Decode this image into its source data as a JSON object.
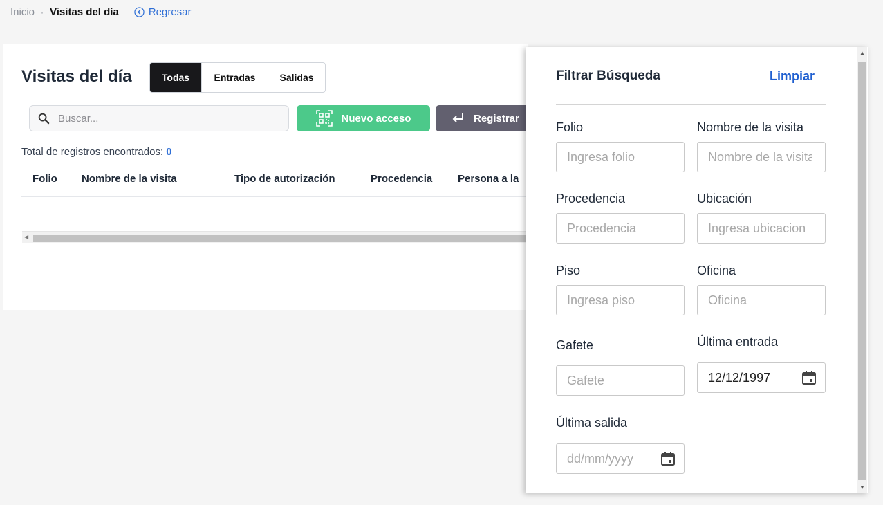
{
  "breadcrumb": {
    "home": "Inicio",
    "separator": "·",
    "current": "Visitas del día",
    "back": "Regresar"
  },
  "page": {
    "title": "Visitas del día"
  },
  "tabs": [
    {
      "label": "Todas",
      "active": true
    },
    {
      "label": "Entradas",
      "active": false
    },
    {
      "label": "Salidas",
      "active": false
    }
  ],
  "search": {
    "placeholder": "Buscar..."
  },
  "actions": {
    "new_access": "Nuevo acceso",
    "register": "Registrar"
  },
  "total": {
    "label": "Total de registros encontrados:",
    "count": "0"
  },
  "table": {
    "columns": [
      "Folio",
      "Nombre de la visita",
      "Tipo de autorización",
      "Procedencia",
      "Persona a la"
    ]
  },
  "filter_panel": {
    "title": "Filtrar Búsqueda",
    "clear": "Limpiar",
    "fields": [
      {
        "label": "Folio",
        "placeholder": "Ingresa folio"
      },
      {
        "label": "Nombre de la visita",
        "placeholder": "Nombre de la visita"
      },
      {
        "label": "Procedencia",
        "placeholder": "Procedencia"
      },
      {
        "label": "Ubicación",
        "placeholder": "Ingresa ubicacion"
      },
      {
        "label": "Piso",
        "placeholder": "Ingresa piso"
      },
      {
        "label": "Oficina",
        "placeholder": "Oficina"
      },
      {
        "label": "Gafete",
        "placeholder": "Gafete"
      },
      {
        "label": "Última entrada",
        "value": "12/12/1997"
      },
      {
        "label": "Última salida",
        "placeholder": "dd/mm/yyyy"
      }
    ]
  },
  "colors": {
    "accent_blue": "#2f6fd6",
    "green_button": "#4cc98a",
    "gray_button": "#62606f",
    "active_tab": "#18181b"
  },
  "icons": {
    "back": "circle-chevron-left-icon",
    "search": "search-icon",
    "qr": "qr-scan-icon",
    "enter": "enter-arrow-icon",
    "calendar": "calendar-icon"
  }
}
